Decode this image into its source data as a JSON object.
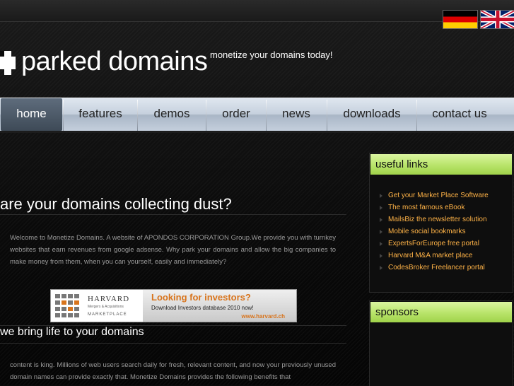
{
  "header": {
    "logo_text": "parked domains",
    "tagline": "monetize your domains today!"
  },
  "languages": [
    {
      "name": "german-flag-icon"
    },
    {
      "name": "uk-flag-icon"
    }
  ],
  "nav": {
    "items": [
      {
        "label": "home",
        "active": true
      },
      {
        "label": "features"
      },
      {
        "label": "demos"
      },
      {
        "label": "order"
      },
      {
        "label": "news"
      },
      {
        "label": "downloads"
      },
      {
        "label": "contact us"
      }
    ]
  },
  "main": {
    "headline": "are your domains collecting dust?",
    "intro": "Welcome to Monetize Domains. A website of APONDOS CORPORATION Group.We provide you with turnkey websites that earn revenues from google adsense. Why park your domains and allow the big companies to make money from them, when you can yourself, easily and immediately?",
    "banner": {
      "brand": "HARVARD",
      "brand_sub": "Mergers & Acquisitions",
      "brand_tag": "MARKETPLACE",
      "headline": "Looking for investors?",
      "body": "Download Investors database 2010 now!",
      "url": "www.harvard.ch"
    },
    "subhead": "we bring life to your domains",
    "body": "content is king. Millions of web users search daily for fresh, relevant content, and now your previously unused domain names can provide exactly that. Monetize Domains provides the following benefits that"
  },
  "sidebar": {
    "useful_links": {
      "title": "useful links",
      "items": [
        "Get your Market Place Software",
        "The most famous eBook",
        "MailsBiz the newsletter solution",
        "Mobile social bookmarks",
        "ExpertsForEurope free portal",
        "Harvard M&A market place",
        "CodesBroker Freelancer portal"
      ]
    },
    "sponsors": {
      "title": "sponsors"
    }
  },
  "colors": {
    "accent_green": "#b8e46a",
    "link_orange": "#ffb347",
    "nav_active": "#4a5765"
  }
}
